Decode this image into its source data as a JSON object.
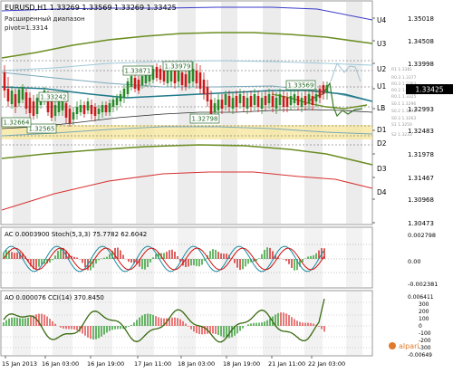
{
  "header": {
    "symbol": "EURUSD,H1",
    "ohlc": "1.33269 1.33569 1.33269 1.33425",
    "indicator_name": "Расширенный диапазон",
    "pivot": "pivot=1.3314"
  },
  "price_axis": {
    "ticks": [
      "1.35018",
      "1.34508",
      "1.33998",
      "1.33425",
      "1.32993",
      "1.32483",
      "1.31978",
      "1.31467",
      "1.30968",
      "1.30473"
    ],
    "current_price": "1.33425"
  },
  "levels": [
    "U4",
    "U3",
    "U2",
    "U1",
    "LB",
    "D1",
    "D2",
    "D3",
    "D4"
  ],
  "small_levels": [
    "R1 1.3381",
    "R0.3 1.3377",
    "R0.3 1.3363",
    "R0.2 1.3342",
    "R0.1 1.3325",
    "S0.1 1.3296",
    "S0.2 1.3272",
    "S0.3 1.3263",
    "S1 1.3250",
    "S2 1.3233"
  ],
  "price_labels": [
    "1.33871",
    "1.33979",
    "1.33242",
    "1.32565",
    "1.32664",
    "1.32798",
    "1.33569"
  ],
  "subpanel_ac": {
    "label": "AC 0.0003900   Stoch(5,3,3) 75.7782 62.6042",
    "ticks": [
      "0.002798",
      "0.00",
      "-0.002381"
    ]
  },
  "subpanel_ao": {
    "label": "AO 0.000076   CCI(14) 370.8450",
    "ticks": [
      "0.006411",
      "300",
      "200",
      "100",
      "0",
      "-100",
      "-200",
      "-300",
      "-0.00649"
    ]
  },
  "time_axis": [
    "15 Jan 2013",
    "16 Jan 03:00",
    "16 Jan 19:00",
    "17 Jan 11:00",
    "18 Jan 03:00",
    "18 Jan 19:00",
    "21 Jan 11:00",
    "22 Jan 03:00"
  ],
  "watermark": "alpari",
  "colors": {
    "up_candle": "#2a8a2a",
    "down_candle": "#cc1a1a",
    "band_green": "#6b8e23",
    "band_blue": "#3a3aca",
    "band_red": "#d83030",
    "teal_ma": "#1f7a8a",
    "highlight": "#f6e7a0"
  }
}
